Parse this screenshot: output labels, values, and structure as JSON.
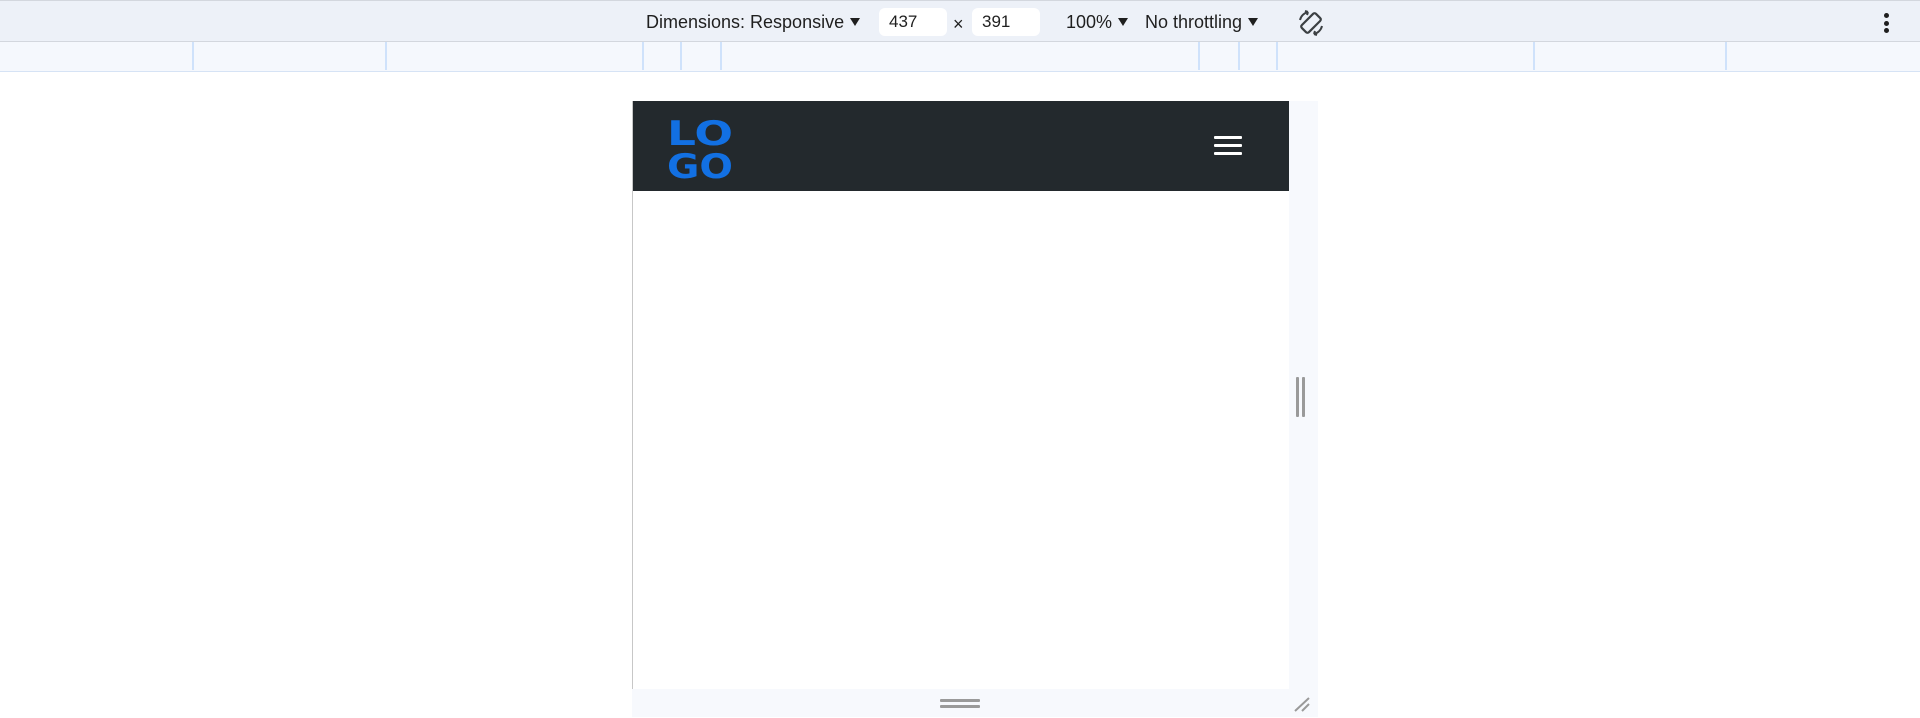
{
  "toolbar": {
    "dimensions_label": "Dimensions: Responsive",
    "width_value": "437",
    "height_value": "391",
    "times_symbol": "×",
    "zoom_label": "100%",
    "throttling_label": "No throttling",
    "text_color": "#1f1f1f",
    "background": "#edf1f8"
  },
  "device": {
    "navbar_background": "#23292d",
    "logo": {
      "line1": "LO",
      "line2": "GO",
      "color": "#1270e3"
    },
    "menu_icon": "hamburger-menu-icon",
    "menu_icon_color": "#ffffff"
  },
  "icons": {
    "rotate": "rotate-icon",
    "more": "kebab-menu-icon",
    "resize_right": "resize-handle-icon",
    "resize_bottom": "resize-handle-icon",
    "resize_corner": "resize-corner-icon"
  }
}
